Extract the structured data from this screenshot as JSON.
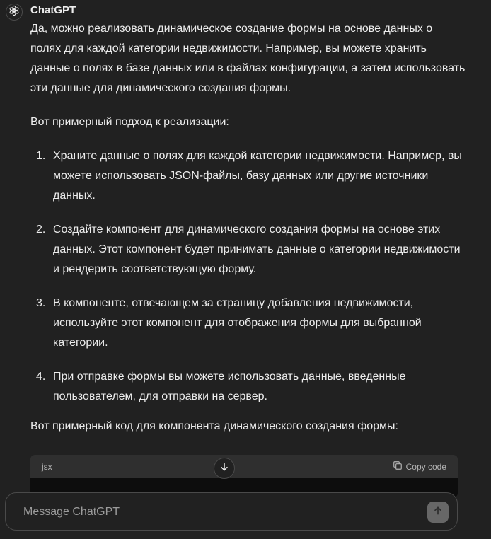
{
  "message": {
    "author": "ChatGPT",
    "paragraphs": {
      "intro": "Да, можно реализовать динамическое создание формы на основе данных о полях для каждой категории недвижимости. Например, вы можете хранить данные о полях в базе данных или в файлах конфигурации, а затем использовать эти данные для динамического создания формы.",
      "approach": "Вот примерный подход к реализации:",
      "code_intro": "Вот примерный код для компонента динамического создания формы:"
    },
    "steps": [
      {
        "number": "1.",
        "text": "Храните данные о полях для каждой категории недвижимости. Например, вы можете использовать JSON-файлы, базу данных или другие источники данных."
      },
      {
        "number": "2.",
        "text": "Создайте компонент для динамического создания формы на основе этих данных. Этот компонент будет принимать данные о категории недвижимости и рендерить соответствующую форму."
      },
      {
        "number": "3.",
        "text": "В компоненте, отвечающем за страницу добавления недвижимости, используйте этот компонент для отображения формы для выбранной категории."
      },
      {
        "number": "4.",
        "text": "При отправке формы вы можете использовать данные, введенные пользователем, для отправки на сервер."
      }
    ]
  },
  "code_block": {
    "language": "jsx",
    "copy_label": "Copy code"
  },
  "composer": {
    "placeholder": "Message ChatGPT"
  },
  "icons": {
    "avatar": "chatgpt-logo-icon",
    "scroll": "arrow-down-icon",
    "copy": "copy-icon",
    "send": "arrow-up-icon"
  },
  "colors": {
    "background": "#212121",
    "text": "#ececec",
    "code_header": "#2f2f2f",
    "code_body": "#0d0d0d",
    "send_button": "#676767"
  }
}
